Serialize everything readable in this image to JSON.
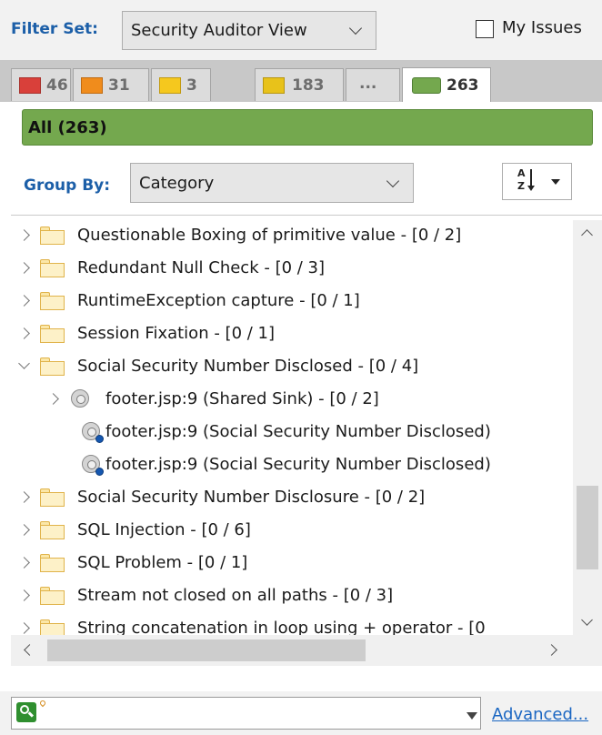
{
  "filter": {
    "label": "Filter Set:",
    "selected": "Security Auditor View",
    "my_issues_label": "My Issues",
    "my_issues_checked": false
  },
  "severity_tabs": [
    {
      "name": "critical",
      "count": "46",
      "color": "#d9403a"
    },
    {
      "name": "high",
      "count": "31",
      "color": "#f08c1c"
    },
    {
      "name": "medium",
      "count": "3",
      "color": "#f5c81e"
    },
    {
      "name": "low",
      "count": "183",
      "color": "#e8c21a"
    },
    {
      "name": "more",
      "count": "..."
    },
    {
      "name": "all",
      "count": "263",
      "color": "#74a84e",
      "active": true
    }
  ],
  "all_bar": {
    "label": "All (263)"
  },
  "group_by": {
    "label": "Group By:",
    "selected": "Category"
  },
  "tree": [
    {
      "type": "folder",
      "state": "collapsed",
      "label": "Questionable Boxing of primitive value - [0 / 2]"
    },
    {
      "type": "folder",
      "state": "collapsed",
      "label": "Redundant Null Check - [0 / 3]"
    },
    {
      "type": "folder",
      "state": "collapsed",
      "label": "RuntimeException capture - [0 / 1]"
    },
    {
      "type": "folder",
      "state": "collapsed",
      "label": "Session Fixation - [0 / 1]"
    },
    {
      "type": "folder",
      "state": "expanded",
      "label": "Social Security Number Disclosed - [0 / 4]"
    },
    {
      "type": "issue-group",
      "state": "collapsed",
      "label": "footer.jsp:9 (Shared Sink) - [0 / 2]"
    },
    {
      "type": "issue",
      "label": "footer.jsp:9 (Social Security Number Disclosed)"
    },
    {
      "type": "issue",
      "label": "footer.jsp:9 (Social Security Number Disclosed)"
    },
    {
      "type": "folder",
      "state": "collapsed",
      "label": "Social Security Number Disclosure - [0 / 2]"
    },
    {
      "type": "folder",
      "state": "collapsed",
      "label": "SQL Injection - [0 / 6]"
    },
    {
      "type": "folder",
      "state": "collapsed",
      "label": "SQL Problem - [0 / 1]"
    },
    {
      "type": "folder",
      "state": "collapsed",
      "label": "Stream not closed on all paths - [0 / 3]"
    },
    {
      "type": "folder",
      "state": "collapsed",
      "label": "String concatenation in loop using + operator - [0"
    }
  ],
  "search": {
    "value": "",
    "advanced_label": "Advanced..."
  }
}
